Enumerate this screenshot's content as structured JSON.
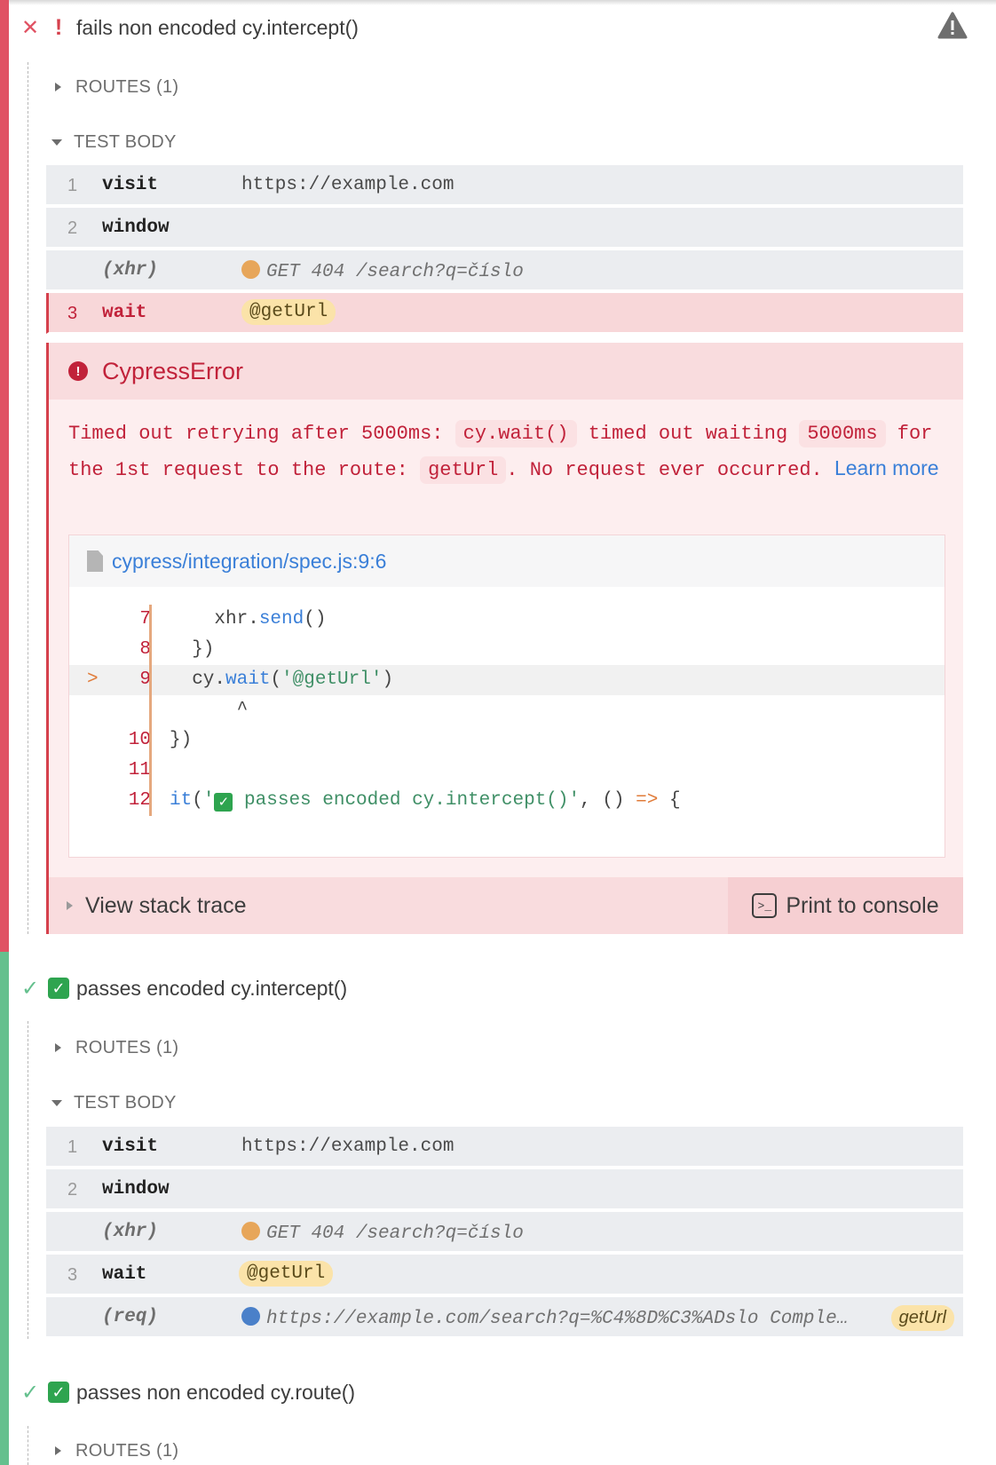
{
  "tests": [
    {
      "title": "fails non encoded cy.intercept()",
      "state": "failed",
      "routes_label": "ROUTES (1)",
      "body_label": "TEST BODY",
      "commands": [
        {
          "num": "1",
          "name": "visit",
          "message": "https://example.com"
        },
        {
          "num": "2",
          "name": "window",
          "message": ""
        },
        {
          "num": "",
          "name": "(xhr)",
          "message": "GET 404 /search?q=číslo"
        },
        {
          "num": "3",
          "name": "wait",
          "message": "@getUrl"
        }
      ],
      "error": {
        "name": "CypressError",
        "msg_1": "Timed out retrying after 5000ms:",
        "code_1": "cy.wait()",
        "msg_2": "timed out waiting",
        "code_2": "5000ms",
        "msg_3": "for the 1st request to the route:",
        "code_3": "getUrl",
        "msg_4": ". No request ever occurred.",
        "learn_more": "Learn more",
        "file": "cypress/integration/spec.js:9:6",
        "code_lines": [
          {
            "ln": "7",
            "src": "    xhr.send()"
          },
          {
            "ln": "8",
            "src": "  })"
          },
          {
            "ln": "9",
            "src": "  cy.wait('@getUrl')",
            "arrow": ">"
          },
          {
            "ln": "",
            "src": "      ^"
          },
          {
            "ln": "10",
            "src": "})"
          },
          {
            "ln": "11",
            "src": ""
          },
          {
            "ln": "12",
            "src": "it('✅ passes encoded cy.intercept()', () => {"
          }
        ],
        "stack_label": "View stack trace",
        "print_label": "Print to console",
        "print_icon": ">_"
      }
    },
    {
      "title": "passes encoded cy.intercept()",
      "state": "passed",
      "routes_label": "ROUTES (1)",
      "body_label": "TEST BODY",
      "commands": [
        {
          "num": "1",
          "name": "visit",
          "message": "https://example.com"
        },
        {
          "num": "2",
          "name": "window",
          "message": ""
        },
        {
          "num": "",
          "name": "(xhr)",
          "message": "GET 404 /search?q=číslo"
        },
        {
          "num": "3",
          "name": "wait",
          "message": "@getUrl"
        },
        {
          "num": "",
          "name": "(req)",
          "message": "https://example.com/search?q=%C4%8D%C3%ADslo Comple…",
          "alias": "getUrl"
        }
      ]
    },
    {
      "title": "passes non encoded cy.route()",
      "state": "passed",
      "routes_label": "ROUTES (1)"
    }
  ],
  "colors": {
    "failed": "#e05263",
    "passed": "#65c08e",
    "accent": "#3a7fd8"
  }
}
